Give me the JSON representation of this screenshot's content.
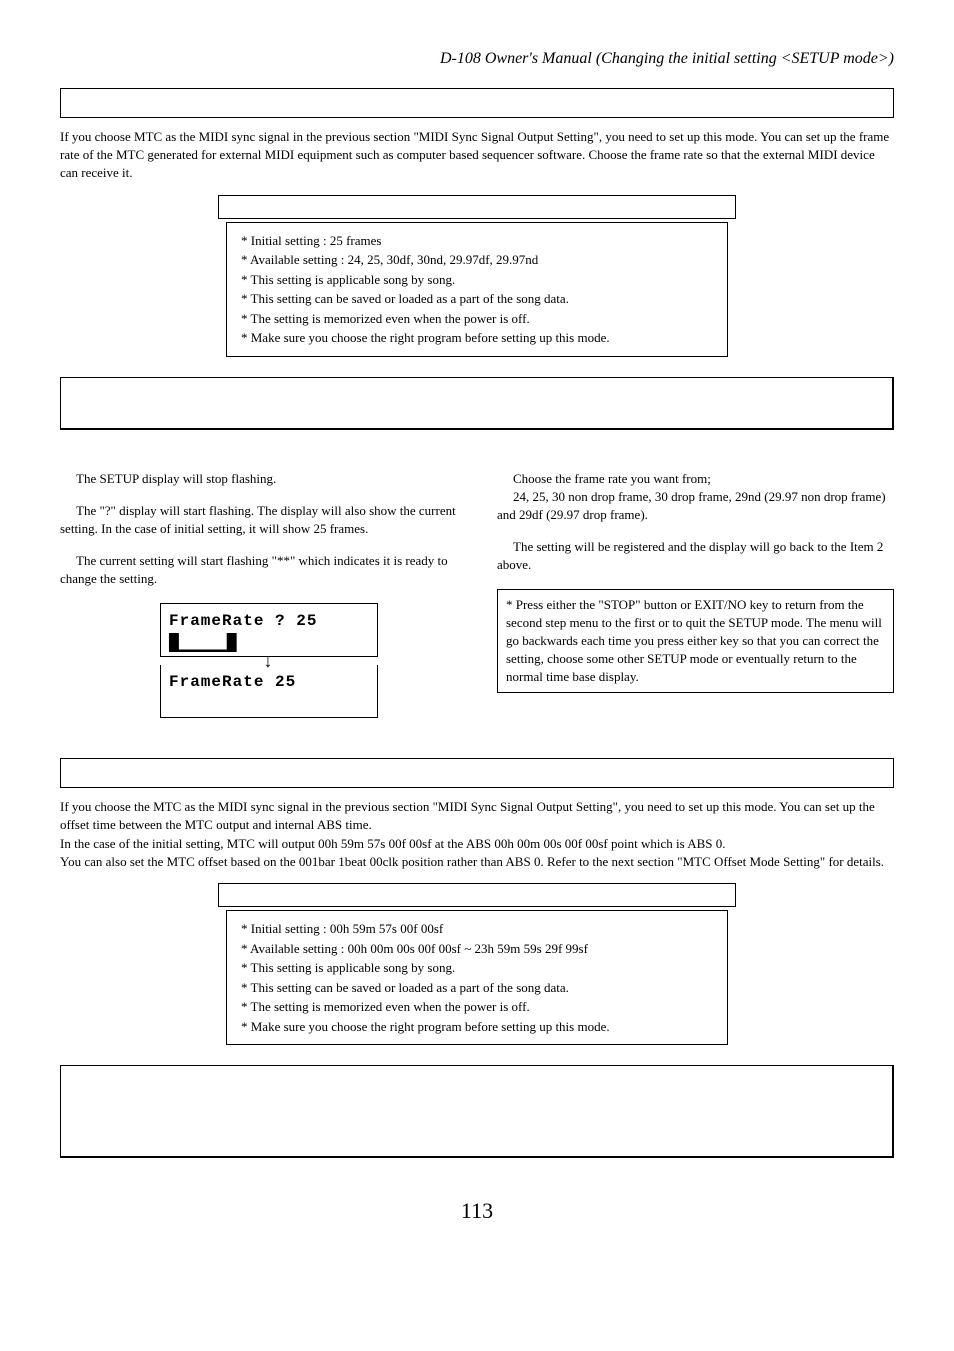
{
  "header": "D-108 Owner's Manual (Changing the initial setting <SETUP mode>)",
  "section1": {
    "intro": "If you choose MTC as the MIDI sync signal in the previous section \"MIDI Sync Signal Output Setting\", you need to set up this mode. You can set up the frame rate of the MTC generated for external MIDI equipment such as computer based sequencer software. Choose the frame rate so that the external MIDI device can receive it.",
    "notes": [
      "* Initial setting : 25 frames",
      "* Available setting : 24, 25, 30df, 30nd, 29.97df, 29.97nd",
      "* This setting is applicable song by song.",
      "* This setting can be saved or loaded as a part of the song data.",
      "* The setting is memorized even when the power is off.",
      "* Make sure you choose the right program before setting up this mode."
    ]
  },
  "columns1": {
    "left": {
      "p1": "The SETUP display will stop flashing.",
      "p2": "The \"?\" display will start flashing.  The display will also show the current setting.  In the case of initial setting, it will show 25 frames.",
      "p3": "The current setting will start flashing \"**\" which indicates it is ready to change the setting.",
      "lcd1_line": "FrameRate ? 25",
      "lcd1_blocks": "█▁▁▁▁▁█",
      "lcd2_line": "FrameRate   25"
    },
    "right": {
      "p1": "Choose the frame rate you want from;",
      "p1b": "24, 25, 30 non drop frame, 30 drop frame, 29nd (29.97 non drop frame) and 29df (29.97 drop frame).",
      "p2": "The setting will be registered and the display will go back to the Item 2 above.",
      "note": "* Press either the \"STOP\" button or EXIT/NO key to return from the second step menu to the first or to quit the SETUP mode. The menu will go backwards each time you press either key so that you can correct the setting, choose some other SETUP mode or eventually return to the normal time base display."
    }
  },
  "section2": {
    "intro": "If you choose the MTC as the MIDI sync signal in the previous section \"MIDI Sync Signal Output Setting\", you need to set up this mode.  You can set up the offset time between the MTC output and internal ABS time.\nIn the case of the initial setting, MTC will output 00h 59m 57s 00f 00sf at the ABS 00h 00m 00s 00f 00sf point which is ABS 0.\nYou can also set the MTC offset based on the 001bar 1beat 00clk position rather than ABS 0.  Refer to the next section \"MTC Offset Mode Setting\" for details.",
    "notes": [
      "* Initial setting : 00h 59m 57s 00f 00sf",
      "* Available setting : 00h 00m 00s 00f 00sf ~ 23h 59m 59s 29f 99sf",
      "* This setting is applicable song by song.",
      "* This setting can be saved or loaded as a part of the song data.",
      "* The setting is memorized even when the power is off.",
      "* Make sure you choose the right program before setting up this mode."
    ]
  },
  "pageNumber": "113"
}
